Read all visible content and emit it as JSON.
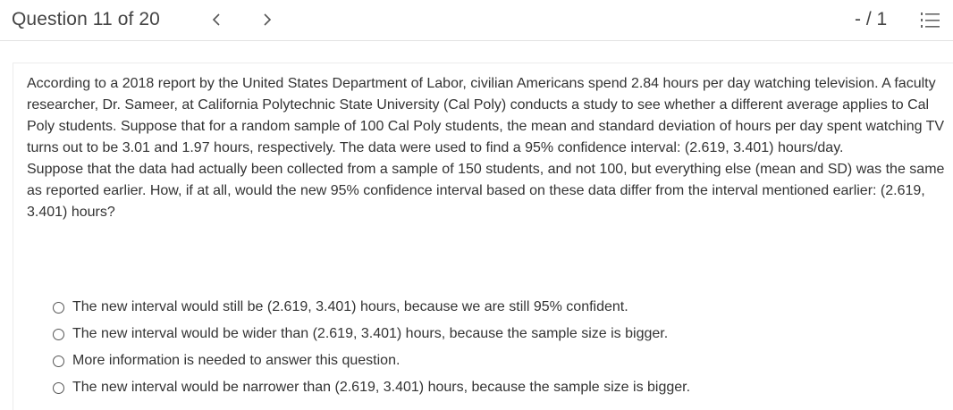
{
  "header": {
    "question_title": "Question 11 of 20",
    "score": "- / 1",
    "prev_icon": "chevron-left-icon",
    "next_icon": "chevron-right-icon",
    "list_icon": "question-list-icon"
  },
  "question": {
    "paragraph1": "According to a 2018 report by the United States Department of Labor, civilian Americans spend 2.84 hours per day watching television. A faculty researcher, Dr. Sameer, at California Polytechnic State University (Cal Poly) conducts a study to see whether a different average applies to Cal Poly students. Suppose that for a random sample of 100 Cal Poly students, the mean and standard deviation of hours per day spent watching TV turns out to be 3.01 and 1.97 hours, respectively. The data were used to find a 95% confidence interval: (2.619, 3.401) hours/day.",
    "paragraph2": "Suppose that the data had actually been collected from a sample of 150 students, and not 100, but everything else (mean and SD) was the same as reported earlier. How, if at all, would the new 95% confidence interval based on these data differ from the interval mentioned earlier: (2.619, 3.401) hours?"
  },
  "options": [
    {
      "label": "The new interval would still be (2.619, 3.401) hours, because we are still 95% confident.",
      "selected": false
    },
    {
      "label": "The new interval would be wider than (2.619, 3.401) hours, because the sample size is bigger.",
      "selected": false
    },
    {
      "label": "More information is needed to answer this question.",
      "selected": false
    },
    {
      "label": "The new interval would be narrower than (2.619, 3.401) hours, because the sample size is bigger.",
      "selected": false
    }
  ]
}
